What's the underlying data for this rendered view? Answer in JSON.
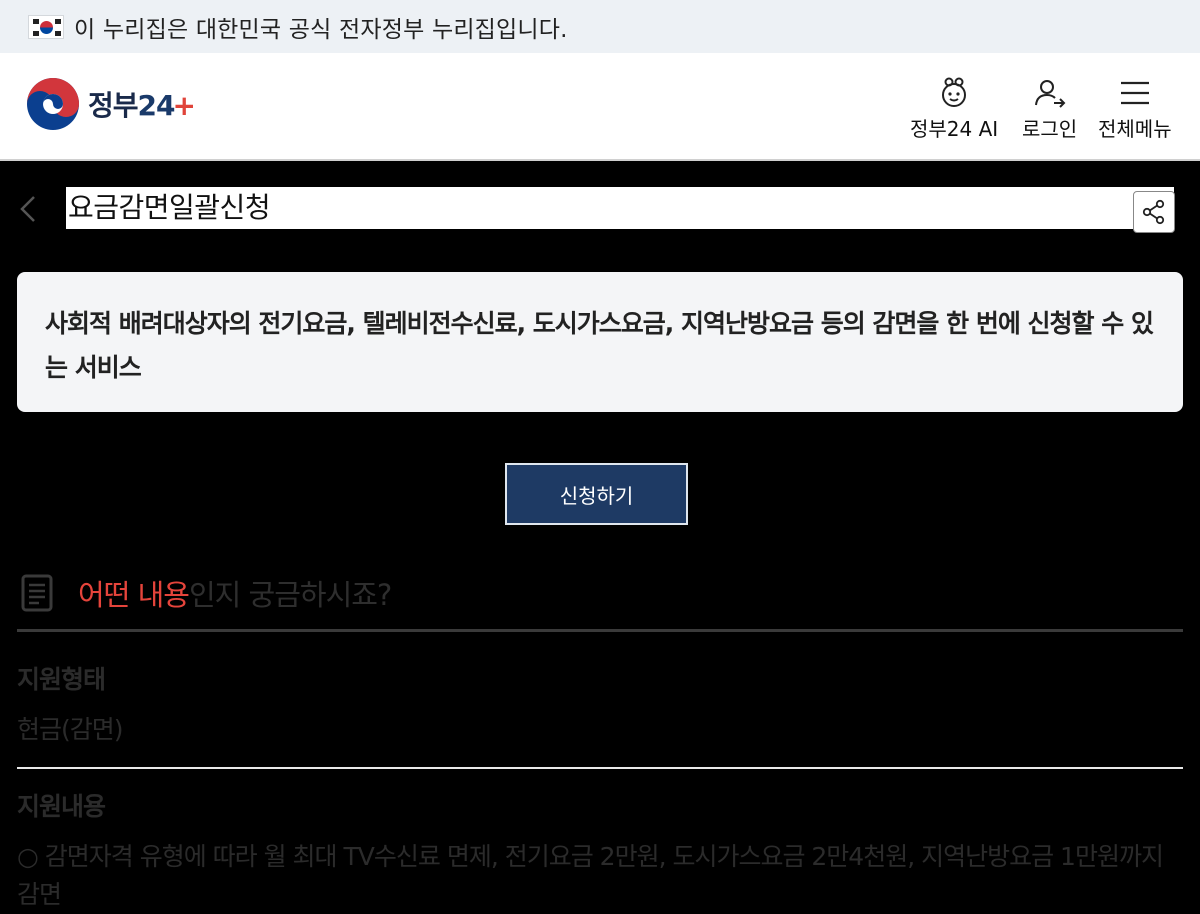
{
  "gov_banner": {
    "flag_icon": "korean-flag-icon",
    "text": "이 누리집은 대한민국 공식 전자정부 누리집입니다."
  },
  "header": {
    "logo_text": "정부",
    "logo_number": "24",
    "logo_plus": "+",
    "ai_label": "정부24 AI",
    "login_label": "로그인",
    "menu_label": "전체메뉴"
  },
  "page": {
    "title": "요금감면일괄신청",
    "summary": "사회적 배려대상자의 전기요금, 텔레비전수신료, 도시가스요금, 지역난방요금 등의 감면을 한 번에 신청할 수 있는 서비스",
    "apply_label": "신청하기"
  },
  "section": {
    "title_highlight": "어떤 내용",
    "title_rest": "인지 궁금하시죠?",
    "support_type_label": "지원형태",
    "support_type_value": "현금(감면)",
    "support_content_label": "지원내용",
    "support_content_value": "○ 감면자격 유형에 따라 월 최대 TV수신료 면제, 전기요금 2만원, 도시가스요금 2만4천원, 지역난방요금 1만원까지 감면"
  },
  "colors": {
    "banner_bg": "#edf1f5",
    "apply_button": "#1e3a64",
    "highlight": "#e5443b",
    "summary_bg": "#f4f5f7"
  }
}
